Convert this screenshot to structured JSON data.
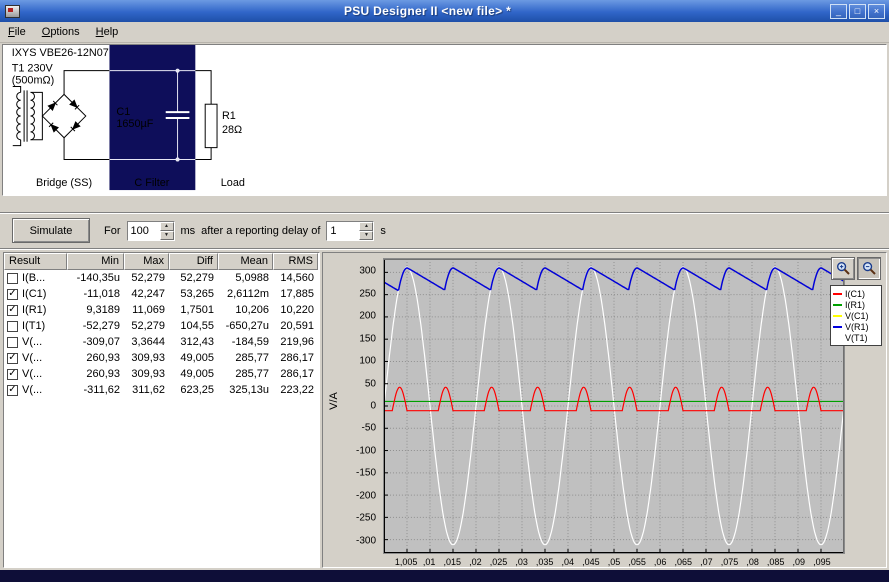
{
  "window": {
    "title": "PSU Designer II  <new file> *",
    "controls": {
      "minimize": "_",
      "maximize": "□",
      "close": "×"
    }
  },
  "menu": {
    "items": [
      "File",
      "Options",
      "Help"
    ]
  },
  "schematic": {
    "rectifier_label": "IXYS  VBE26-12N07",
    "transformer_line1": "T1 230V",
    "transformer_line2": "(500mΩ)",
    "capacitor_line1": "C1",
    "capacitor_line2": "1650µF",
    "resistor_line1": "R1",
    "resistor_line2": "28Ω",
    "section_labels": [
      "Bridge (SS)",
      "C Filter",
      "Load"
    ]
  },
  "toolbar": {
    "simulate": "Simulate",
    "for": "For",
    "duration": "100",
    "ms_label": "ms",
    "after_label": "after a reporting delay of",
    "delay": "1",
    "s_label": "s"
  },
  "results": {
    "columns": [
      "Result",
      "Min",
      "Max",
      "Diff",
      "Mean",
      "RMS"
    ],
    "rows": [
      {
        "checked": false,
        "name": "I(B...",
        "min": "-140,35u",
        "max": "52,279",
        "diff": "52,279",
        "mean": "5,0988",
        "rms": "14,560"
      },
      {
        "checked": true,
        "name": "I(C1)",
        "min": "-11,018",
        "max": "42,247",
        "diff": "53,265",
        "mean": "2,6112m",
        "rms": "17,885"
      },
      {
        "checked": true,
        "name": "I(R1)",
        "min": "9,3189",
        "max": "11,069",
        "diff": "1,7501",
        "mean": "10,206",
        "rms": "10,220"
      },
      {
        "checked": false,
        "name": "I(T1)",
        "min": "-52,279",
        "max": "52,279",
        "diff": "104,55",
        "mean": "-650,27u",
        "rms": "20,591"
      },
      {
        "checked": false,
        "name": "V(...",
        "min": "-309,07",
        "max": "3,3644",
        "diff": "312,43",
        "mean": "-184,59",
        "rms": "219,96"
      },
      {
        "checked": true,
        "name": "V(...",
        "min": "260,93",
        "max": "309,93",
        "diff": "49,005",
        "mean": "285,77",
        "rms": "286,17"
      },
      {
        "checked": true,
        "name": "V(...",
        "min": "260,93",
        "max": "309,93",
        "diff": "49,005",
        "mean": "285,77",
        "rms": "286,17"
      },
      {
        "checked": true,
        "name": "V(...",
        "min": "-311,62",
        "max": "311,62",
        "diff": "623,25",
        "mean": "325,13u",
        "rms": "223,22"
      }
    ]
  },
  "plot": {
    "ylabel": "V/A",
    "tools": [
      "zoom-in-icon",
      "zoom-out-icon"
    ],
    "legend": [
      {
        "label": "I(C1)",
        "color": "#ff0000"
      },
      {
        "label": "I(R1)",
        "color": "#00a000"
      },
      {
        "label": "V(C1)",
        "color": "#ffff00"
      },
      {
        "label": "V(R1)",
        "color": "#0000dd"
      },
      {
        "label": "V(T1)",
        "color": "#ffffff"
      }
    ]
  },
  "chart_data": {
    "type": "line",
    "title": "",
    "xlabel": "",
    "ylabel": "V/A",
    "xlim": [
      1.0,
      1.1
    ],
    "ylim": [
      -330,
      330
    ],
    "grid": true,
    "legend_position": "right",
    "x_ticks": [
      {
        "v": 1.005,
        "label": "1,005"
      },
      {
        "v": 1.01,
        "label": ",01"
      },
      {
        "v": 1.015,
        "label": ",015"
      },
      {
        "v": 1.02,
        "label": ",02"
      },
      {
        "v": 1.025,
        "label": ",025"
      },
      {
        "v": 1.03,
        "label": ",03"
      },
      {
        "v": 1.035,
        "label": ",035"
      },
      {
        "v": 1.04,
        "label": ",04"
      },
      {
        "v": 1.045,
        "label": ",045"
      },
      {
        "v": 1.05,
        "label": ",05"
      },
      {
        "v": 1.055,
        "label": ",055"
      },
      {
        "v": 1.06,
        "label": ",06"
      },
      {
        "v": 1.065,
        "label": ",065"
      },
      {
        "v": 1.07,
        "label": ",07"
      },
      {
        "v": 1.075,
        "label": ",075"
      },
      {
        "v": 1.08,
        "label": ",08"
      },
      {
        "v": 1.085,
        "label": ",085"
      },
      {
        "v": 1.09,
        "label": ",09"
      },
      {
        "v": 1.095,
        "label": ",095"
      }
    ],
    "y_ticks": [
      300,
      250,
      200,
      150,
      100,
      50,
      0,
      -50,
      -100,
      -150,
      -200,
      -250,
      -300
    ],
    "series": [
      {
        "name": "V(C1)",
        "color": "#ffff00",
        "kind": "ripple",
        "v_min": 260.93,
        "v_max": 309.93,
        "ripple_freq_hz": 100,
        "decay_ms": 8
      },
      {
        "name": "V(T1)",
        "color": "#ffffff",
        "kind": "sine",
        "amplitude": 311.62,
        "freq_hz": 50
      },
      {
        "name": "I(R1)",
        "color": "#00a000",
        "kind": "constant",
        "value": 10.2
      },
      {
        "name": "I(C1)",
        "color": "#ff0000",
        "kind": "pulses",
        "base": -10.5,
        "peak": 42.2,
        "freq_hz": 100,
        "pulse_width_ms": 3.2,
        "first_peak_ms": 5
      },
      {
        "name": "V(R1)",
        "color": "#0000dd",
        "kind": "ripple",
        "v_min": 260.93,
        "v_max": 309.93,
        "ripple_freq_hz": 100,
        "decay_ms": 8
      }
    ]
  }
}
